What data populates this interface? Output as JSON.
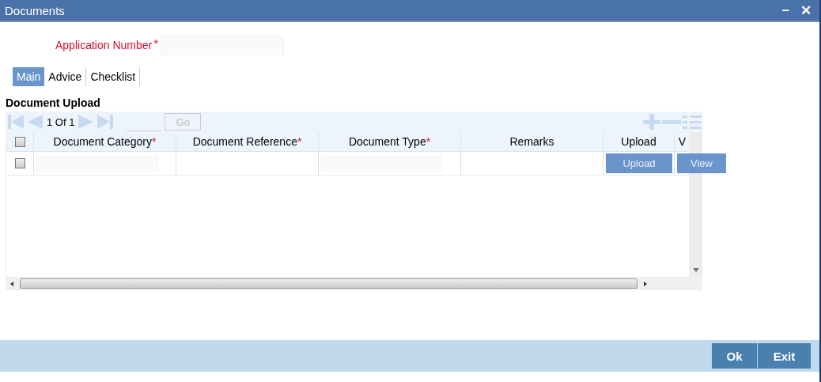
{
  "window": {
    "title": "Documents",
    "controls": [
      "–",
      "✕"
    ]
  },
  "application_number": {
    "label": "Application Number",
    "required_mark": "*"
  },
  "tabs": [
    {
      "label": "Main",
      "selected": true
    },
    {
      "label": "Advice",
      "selected": false
    },
    {
      "label": "Checklist",
      "selected": false
    }
  ],
  "section_title": "Document Upload",
  "pager": {
    "text": "1 Of 1",
    "go": "Go"
  },
  "table": {
    "select_all": {
      "checked": false
    },
    "columns": [
      {
        "label": "Document Category",
        "required_mark": "*"
      },
      {
        "label": "Document Reference",
        "required_mark": "*"
      },
      {
        "label": "Document Type",
        "required_mark": "*"
      },
      {
        "label": "Remarks"
      },
      {
        "label": "Upload"
      },
      {
        "label": "V"
      }
    ],
    "rows": [
      {
        "checked": false,
        "upload_button": "Upload",
        "view_button": "View"
      }
    ]
  },
  "buttons": [
    "Ok",
    "Exit"
  ]
}
